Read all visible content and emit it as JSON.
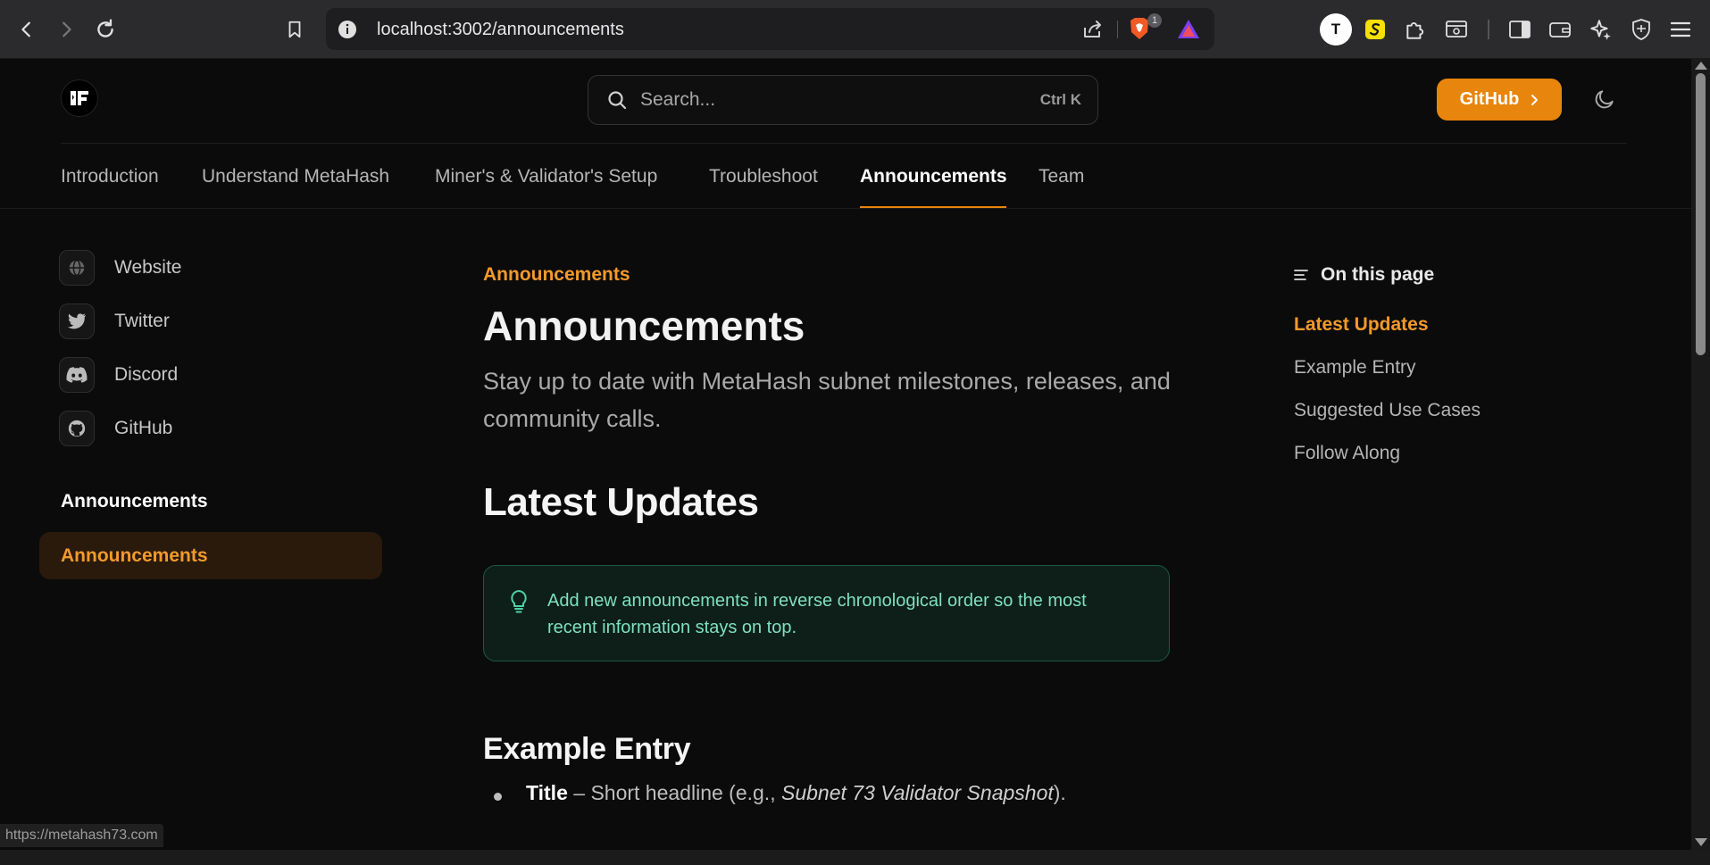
{
  "browser": {
    "url": "localhost:3002/announcements",
    "shield_badge_count": "1",
    "profile_initial": "T"
  },
  "header": {
    "search_placeholder": "Search...",
    "search_shortcut": "Ctrl K",
    "github_button": "GitHub"
  },
  "tabs": [
    {
      "label": "Introduction"
    },
    {
      "label": "Understand MetaHash"
    },
    {
      "label": "Miner's & Validator's Setup"
    },
    {
      "label": "Troubleshoot"
    },
    {
      "label": "Announcements",
      "active": true
    },
    {
      "label": "Team"
    }
  ],
  "sidebar": {
    "links": [
      {
        "label": "Website",
        "icon": "globe-icon"
      },
      {
        "label": "Twitter",
        "icon": "twitter-icon"
      },
      {
        "label": "Discord",
        "icon": "discord-icon"
      },
      {
        "label": "GitHub",
        "icon": "github-icon"
      }
    ],
    "section_heading": "Announcements",
    "active_item": "Announcements"
  },
  "main": {
    "breadcrumb": "Announcements",
    "title": "Announcements",
    "lead": "Stay up to date with MetaHash subnet milestones, releases, and community calls.",
    "latest_heading": "Latest Updates",
    "callout": "Add new announcements in reverse chronological order so the most recent information stays on top.",
    "example_heading": "Example Entry",
    "list_item": {
      "term": "Title",
      "text": " – Short headline (e.g., ",
      "example": "Subnet 73 Validator Snapshot",
      "end": ")."
    }
  },
  "toc": {
    "title": "On this page",
    "items": [
      "Latest Updates",
      "Example Entry",
      "Suggested Use Cases",
      "Follow Along"
    ]
  },
  "status_bar": "https://metahash73.com",
  "colors": {
    "accent": "#e8850c",
    "callout_bg": "#0d1f18",
    "callout_text": "#7fe0c2"
  }
}
